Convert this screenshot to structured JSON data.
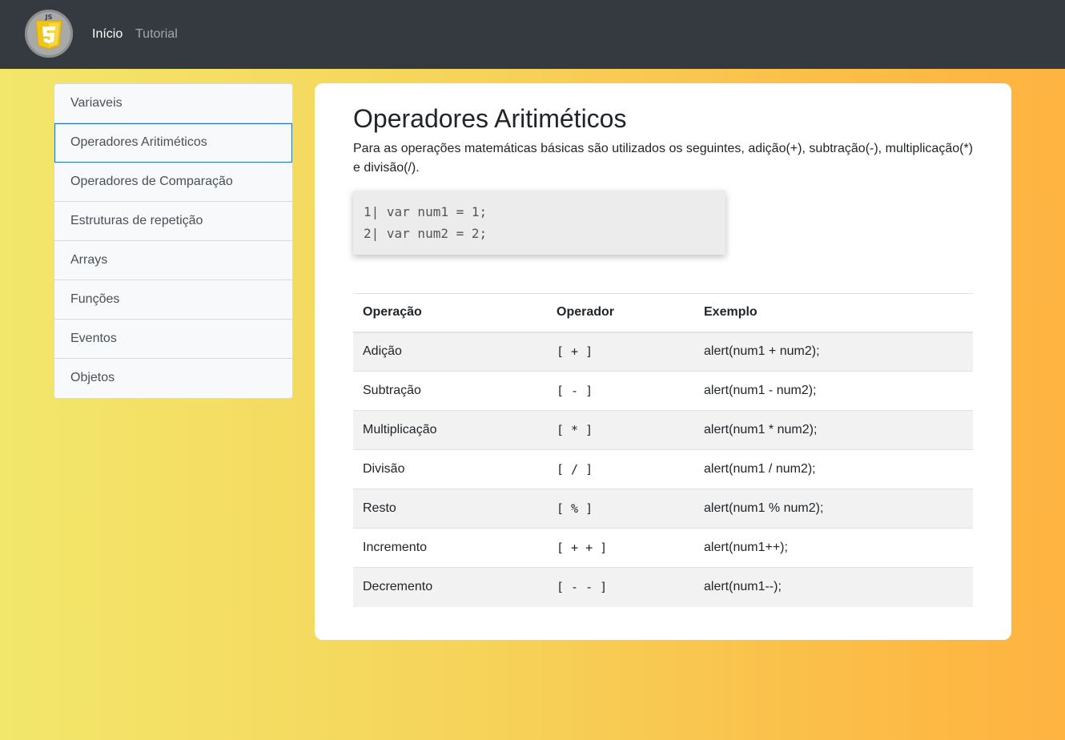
{
  "navbar": {
    "logo_text": "JS",
    "home_label": "Início",
    "tutorial_label": "Tutorial"
  },
  "sidebar": {
    "items": [
      {
        "label": "Variaveis",
        "active": false
      },
      {
        "label": "Operadores Aritiméticos",
        "active": true
      },
      {
        "label": "Operadores de Comparação",
        "active": false
      },
      {
        "label": "Estruturas de repetição",
        "active": false
      },
      {
        "label": "Arrays",
        "active": false
      },
      {
        "label": "Funções",
        "active": false
      },
      {
        "label": "Eventos",
        "active": false
      },
      {
        "label": "Objetos",
        "active": false
      }
    ]
  },
  "main": {
    "title": "Operadores Aritiméticos",
    "intro": "Para as operações matemáticas básicas são utilizados os seguintes, adição(+), subtração(-), multiplicação(*) e divisão(/).",
    "code_lines": [
      "1| var num1 = 1;",
      "2| var num2 = 2;"
    ],
    "table": {
      "headers": [
        "Operação",
        "Operador",
        "Exemplo"
      ],
      "rows": [
        [
          "Adição",
          "[ + ]",
          "alert(num1 + num2);"
        ],
        [
          "Subtração",
          "[ - ]",
          "alert(num1 - num2);"
        ],
        [
          "Multiplicação",
          "[ * ]",
          "alert(num1 * num2);"
        ],
        [
          "Divisão",
          "[ / ]",
          "alert(num1 / num2);"
        ],
        [
          "Resto",
          "[ % ]",
          "alert(num1 % num2);"
        ],
        [
          "Incremento",
          "[ + + ]",
          "alert(num1++);"
        ],
        [
          "Decremento",
          "[ - - ]",
          "alert(num1--);"
        ]
      ]
    }
  },
  "colors": {
    "navbar_bg": "#343a40",
    "active_border": "#1e73be",
    "gradient_start": "#f2e76b",
    "gradient_end": "#ffb341"
  }
}
